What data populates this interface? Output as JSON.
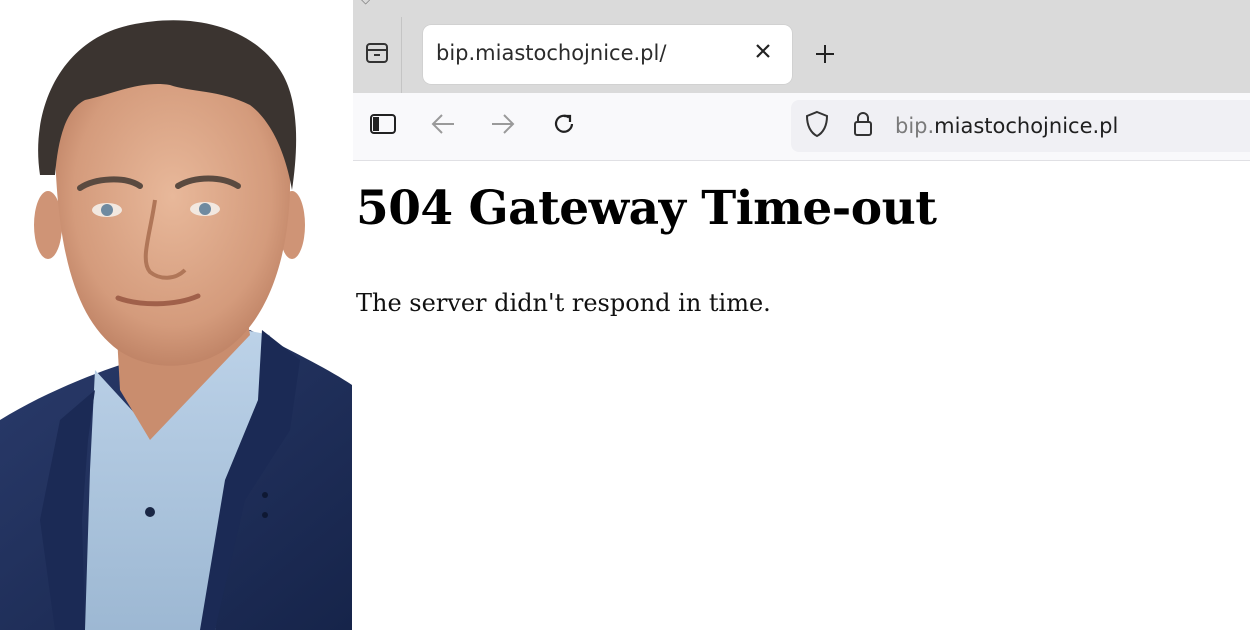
{
  "tab": {
    "title": "bip.miastochojnice.pl/",
    "close_label": "×",
    "new_tab_label": "+"
  },
  "urlbar": {
    "prefix": "bip.",
    "domain": "miastochojnice.pl"
  },
  "page": {
    "heading": "504 Gateway Time-out",
    "message": "The server didn't respond in time."
  },
  "icons": {
    "tab_list": "tab-list-icon",
    "sidebar": "sidebar-icon",
    "back": "back-arrow-icon",
    "forward": "forward-arrow-icon",
    "reload": "reload-icon",
    "shield": "shield-icon",
    "lock": "lock-icon"
  },
  "colors": {
    "tabstrip_bg": "#dadada",
    "navbar_bg": "#f9f9fb",
    "urlbar_bg": "#f0f0f4",
    "jacket": "#1f2f5c",
    "shirt": "#a9c4de"
  }
}
